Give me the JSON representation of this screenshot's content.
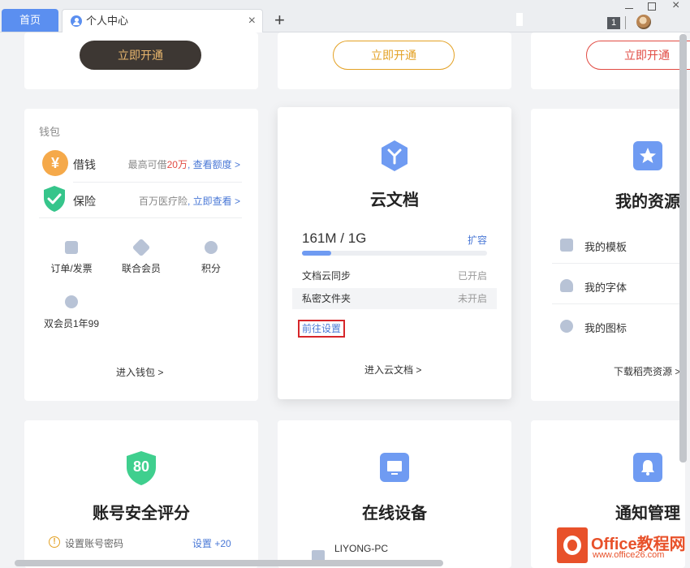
{
  "tabs": {
    "home_label": "首页",
    "active_label": "个人中心",
    "close_glyph": "×",
    "add_glyph": "+",
    "badge_count": "1"
  },
  "window": {
    "close_glyph": "×"
  },
  "top_row": {
    "buttons": [
      "立即开通",
      "立即开通",
      "立即开通"
    ]
  },
  "wallet": {
    "section_label": "钱包",
    "rows": [
      {
        "icon": "yen-coin-icon",
        "title": "借钱",
        "desc_prefix": "最高可借",
        "desc_highlight": "20万",
        "desc_link": ", 查看额度 >"
      },
      {
        "icon": "shield-check-icon",
        "title": "保险",
        "desc_prefix": "百万医疗险",
        "desc_highlight": "",
        "desc_link": ", 立即查看 >"
      }
    ],
    "grid": [
      {
        "icon": "yen-receipt-icon",
        "label": "订单/发票"
      },
      {
        "icon": "member-gem-icon",
        "label": "联合会员"
      },
      {
        "icon": "points-icon",
        "label": "积分"
      },
      {
        "icon": "w-coin-icon",
        "label": "双会员1年99"
      }
    ],
    "enter_link": "进入钱包 >"
  },
  "cloud_doc": {
    "title": "云文档",
    "storage_used": "161M / 1G",
    "expand_label": "扩容",
    "usage_fraction": 0.157,
    "settings": [
      {
        "label": "文档云同步",
        "value": "已开启"
      },
      {
        "label": "私密文件夹",
        "value": "未开启"
      }
    ],
    "goto_settings": "前往设置",
    "enter_link": "进入云文档 >"
  },
  "resources": {
    "title": "我的资源",
    "items": [
      {
        "icon": "template-grid-icon",
        "label": "我的模板"
      },
      {
        "icon": "cloud-font-icon",
        "label": "我的字体"
      },
      {
        "icon": "triangle-icon",
        "label": "我的图标"
      }
    ],
    "download_link": "下载稻壳资源 >"
  },
  "security": {
    "score": "80",
    "title": "账号安全评分",
    "tip": "设置账号密码",
    "tip_action": "设置 +20"
  },
  "devices": {
    "title": "在线设备",
    "device_name": "LIYONG-PC"
  },
  "notify": {
    "title": "通知管理"
  },
  "watermark": {
    "brand": "Office教程网",
    "url": "www.office26.com"
  },
  "colors": {
    "accent_blue": "#5b8ff0",
    "gold": "#e3a124",
    "red": "#e14a42",
    "dark_button": "#3d3733"
  }
}
